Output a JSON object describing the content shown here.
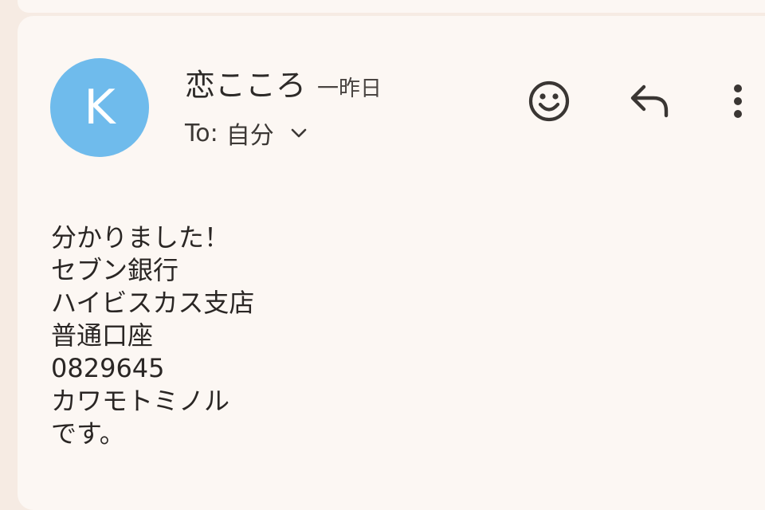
{
  "message": {
    "avatar_letter": "K",
    "sender_name": "恋こころ",
    "time": "一昨日",
    "to_label": "To:",
    "to_value": "自分",
    "body_lines": [
      "分かりました！",
      "セブン銀行",
      "ハイビスカス支店",
      "普通口座",
      "0829645",
      "カワモトミノル",
      "です。"
    ]
  },
  "icons": {
    "details_toggle": "chevron-down-icon",
    "emoji": "emoji-smile-icon",
    "reply": "reply-icon",
    "more": "more-vert-icon"
  },
  "colors": {
    "background": "#f6ebe3",
    "card": "#fcf7f3",
    "avatar": "#6fbbec",
    "text": "#2d2a28"
  }
}
